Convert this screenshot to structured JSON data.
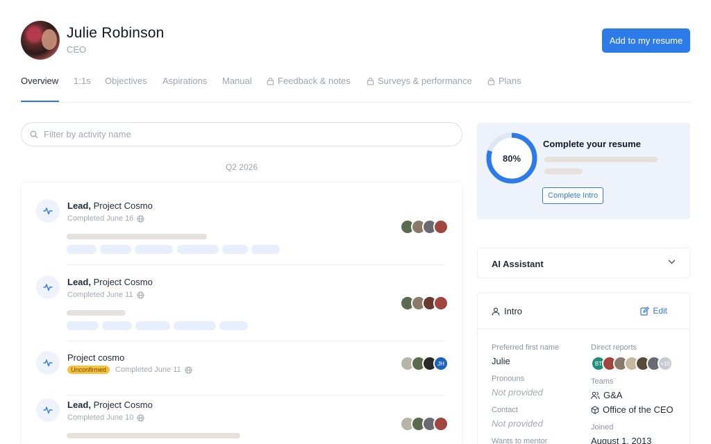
{
  "profile": {
    "name": "Julie Robinson",
    "role": "CEO",
    "add_button": "Add to my resume"
  },
  "tabs": [
    {
      "label": "Overview",
      "active": true,
      "locked": false
    },
    {
      "label": "1:1s",
      "active": false,
      "locked": false
    },
    {
      "label": "Objectives",
      "active": false,
      "locked": false
    },
    {
      "label": "Aspirations",
      "active": false,
      "locked": false
    },
    {
      "label": "Manual",
      "active": false,
      "locked": false
    },
    {
      "label": "Feedback & notes",
      "active": false,
      "locked": true
    },
    {
      "label": "Surveys & performance",
      "active": false,
      "locked": true
    },
    {
      "label": "Plans",
      "active": false,
      "locked": true
    }
  ],
  "filter": {
    "placeholder": "Filter by activity name"
  },
  "feed": {
    "quarter": "Q2 2026",
    "items": [
      {
        "role": "Lead,",
        "project": " Project Cosmo",
        "status": "Completed June 16",
        "badge": ""
      },
      {
        "role": "Lead,",
        "project": " Project Cosmo",
        "status": "Completed June 11",
        "badge": ""
      },
      {
        "role": "",
        "project": "Project cosmo",
        "status": "Completed June 11",
        "badge": "Unconfirmed",
        "initials": "JH"
      },
      {
        "role": "Lead,",
        "project": " Project Cosmo",
        "status": "Completed June 10",
        "badge": ""
      }
    ]
  },
  "resume": {
    "percent": 80,
    "percent_label": "80%",
    "title": "Complete your resume",
    "button": "Complete Intro"
  },
  "ai": {
    "title": "AI Assistant"
  },
  "intro": {
    "title": "Intro",
    "edit": "Edit",
    "preferred_label": "Preferred first name",
    "preferred_value": "Julie",
    "pronouns_label": "Pronouns",
    "pronouns_value": "Not provided",
    "contact_label": "Contact",
    "contact_value": "Not provided",
    "mentor_label": "Wants to mentor",
    "reports_label": "Direct reports",
    "reports_initials": "BT",
    "reports_more": "+10",
    "teams_label": "Teams",
    "team_1": "G&A",
    "team_2": "Office of the CEO",
    "joined_label": "Joined",
    "joined_value": "August 1, 2013"
  },
  "colors": {
    "accent": "#2d7be8",
    "badge": "#f6c23e",
    "card_bg": "#eef2fa"
  }
}
